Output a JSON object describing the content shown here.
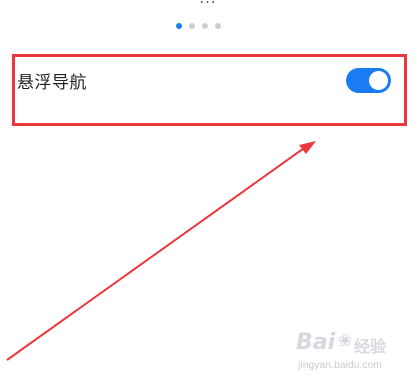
{
  "top_text": "...",
  "pager": {
    "count": 4,
    "active_index": 0
  },
  "setting": {
    "label": "悬浮导航",
    "toggle_on": true
  },
  "colors": {
    "accent": "#1a7cf2",
    "highlight_border": "#e8383d",
    "arrow": "#e8383d"
  },
  "watermark": {
    "logo_text": "Bai",
    "logo_text_cn": "经验",
    "url": "jingyan.baidu.com"
  }
}
